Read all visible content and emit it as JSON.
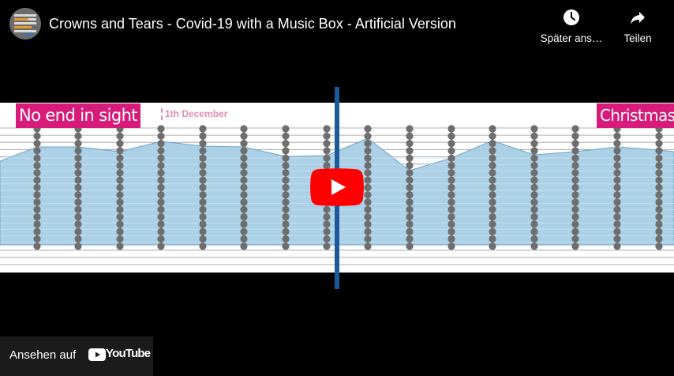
{
  "video": {
    "title": "Crowns and Tears - Covid-19 with a Music Box - Artificial Version",
    "watch_later_label": "Später ans…",
    "share_label": "Teilen",
    "watch_on_label": "Ansehen auf",
    "youtube_label": "YouTube"
  },
  "frame": {
    "banner_left": "No end in sight",
    "banner_right": "Christmas is",
    "date_marker": "1th December"
  },
  "colors": {
    "banner": "#d81b7a",
    "area_fill": "#a8cfe6",
    "playhead": "#1d5a9a",
    "play_button": "#ff0000"
  },
  "icons": [
    "clock-icon",
    "share-arrow-icon",
    "play-icon",
    "youtube-logo-icon"
  ]
}
